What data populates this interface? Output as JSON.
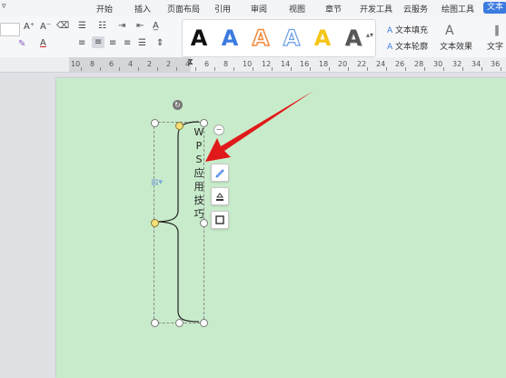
{
  "menu": {
    "tabs": [
      "开始",
      "插入",
      "页面布局",
      "引用",
      "审阅",
      "视图",
      "章节",
      "开发工具",
      "云服务",
      "绘图工具",
      "文本"
    ],
    "active_tab": "文本"
  },
  "ribbon": {
    "font_inc": "A⁺",
    "font_dec": "A⁻",
    "text_fill": "文本填充",
    "text_outline": "文本轮廓",
    "text_effect": "文本效果",
    "text_dir": "文字",
    "art_letter": "A",
    "art_colors": [
      "#111111",
      "#3b7be0",
      "#f08a3c",
      "#6a9fe6",
      "#f5c518",
      "#555555"
    ]
  },
  "ruler": {
    "labels": [
      "10",
      "8",
      "6",
      "4",
      "2",
      "2",
      "4",
      "6",
      "8",
      "10",
      "12",
      "14",
      "16",
      "18",
      "20",
      "22",
      "24",
      "26",
      "28",
      "30",
      "32",
      "34",
      "36"
    ]
  },
  "textbox": {
    "chars": [
      "W",
      "P",
      "S",
      "应",
      "用",
      "技",
      "巧"
    ]
  },
  "colors": {
    "page": "#c8eccb",
    "accent": "#3b7be0",
    "arrow": "#e01a1a"
  },
  "icons": [
    "rotate-icon",
    "layout-icon",
    "collapse-icon",
    "brush-icon",
    "fill-icon",
    "border-icon",
    "arrow-annotation"
  ]
}
